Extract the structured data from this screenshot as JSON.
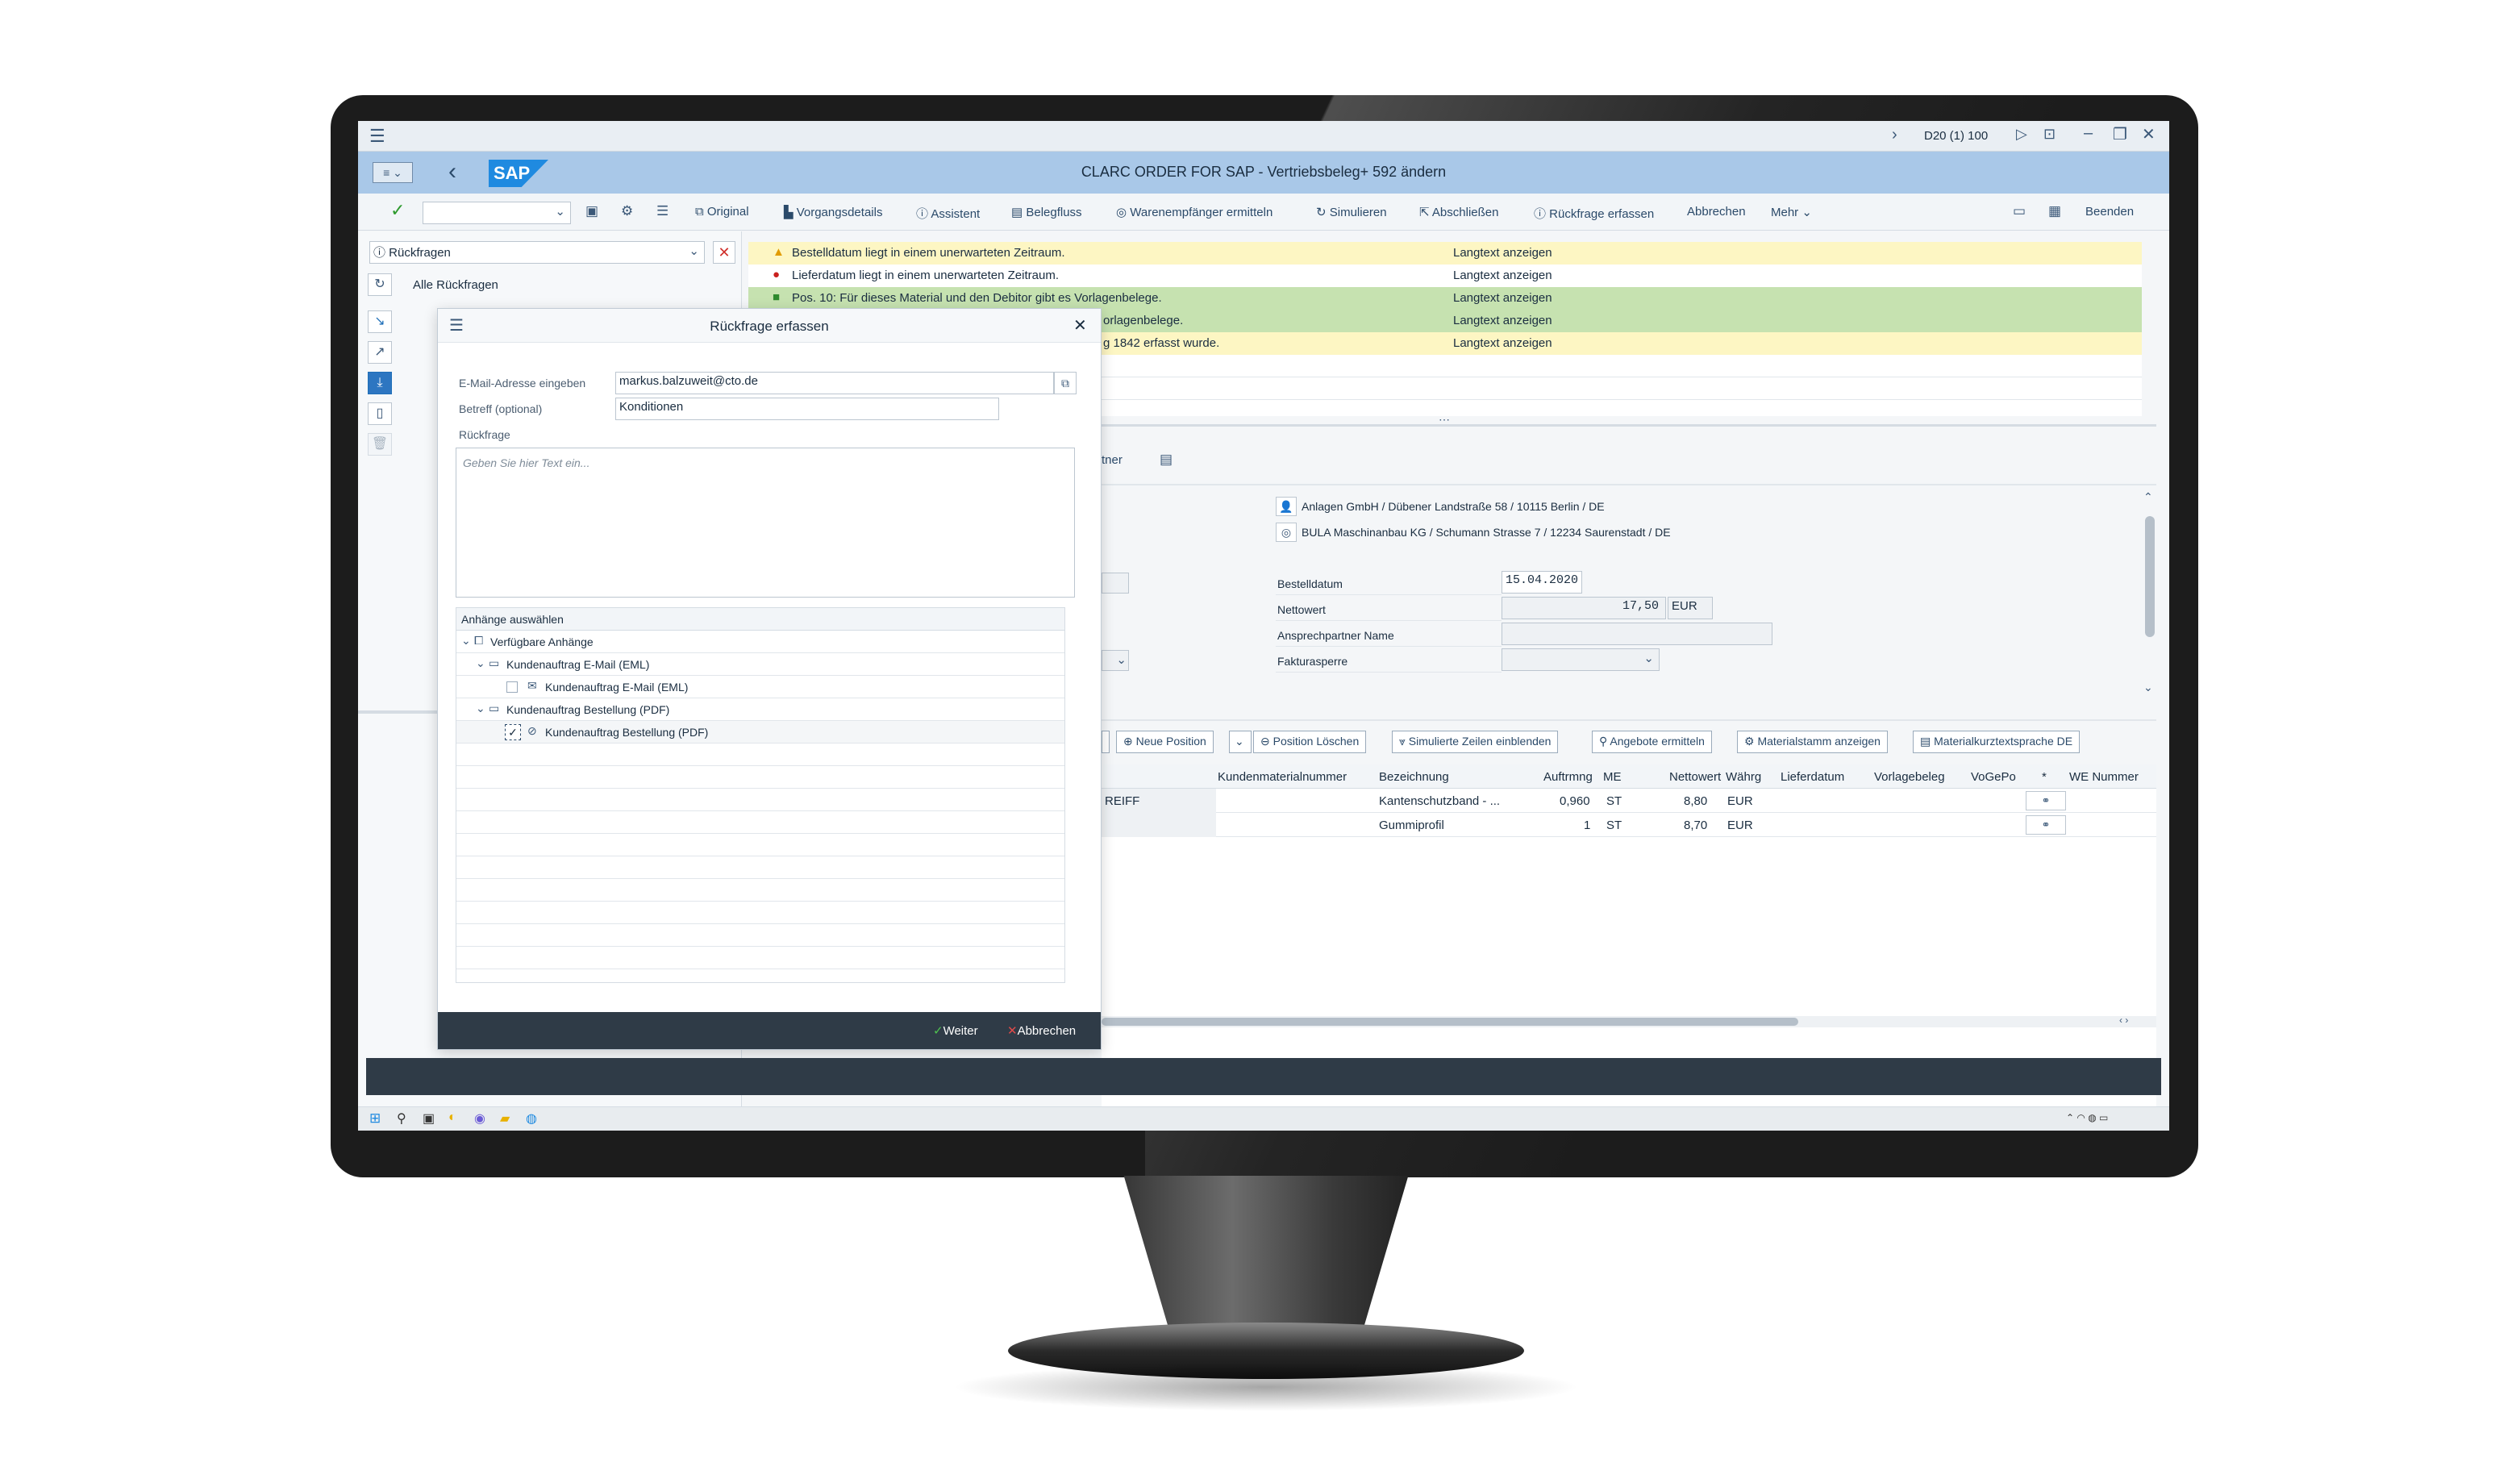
{
  "window": {
    "system_label": "D20 (1) 100",
    "title": "CLARC ORDER FOR SAP - Vertriebsbeleg+ 592 ändern",
    "logo_text": "SAP"
  },
  "toolbar": {
    "original": "Original",
    "vorgangsdetails": "Vorgangsdetails",
    "assistent": "Assistent",
    "belegfluss": "Belegfluss",
    "warenempfaenger": "Warenempfänger ermitteln",
    "simulieren": "Simulieren",
    "abschliessen": "Abschließen",
    "rueckfrage": "Rückfrage erfassen",
    "abbrechen": "Abbrechen",
    "mehr": "Mehr",
    "beenden": "Beenden"
  },
  "left_panel": {
    "dropdown": "Rückfragen",
    "all_label": "Alle Rückfragen"
  },
  "messages": [
    {
      "type": "warning",
      "text": "Bestelldatum liegt in einem unerwarteten Zeitraum.",
      "action": "Langtext anzeigen"
    },
    {
      "type": "error",
      "text": "Lieferdatum liegt in einem unerwarteten Zeitraum.",
      "action": "Langtext anzeigen"
    },
    {
      "type": "success",
      "text": "Pos. 10: Für dieses Material und den Debitor gibt es Vorlagenbelege.",
      "action": "Langtext anzeigen"
    },
    {
      "type": "success",
      "text": "orlagenbelege.",
      "action": "Langtext anzeigen"
    },
    {
      "type": "warning",
      "text": "g 1842 erfasst wurde.",
      "action": "Langtext anzeigen"
    }
  ],
  "main": {
    "tab_partial": "tner",
    "partner1": "Anlagen GmbH / Dübener Landstraße 58 / 10115 Berlin / DE",
    "partner2": "BULA Maschinanbau KG / Schumann Strasse 7 / 12234 Saurenstadt / DE",
    "bestelldatum_label": "Bestelldatum",
    "bestelldatum_value": "15.04.2020",
    "nettowert_label": "Nettowert",
    "nettowert_value": "17,50",
    "nettowert_currency": "EUR",
    "ansprech_label": "Ansprechpartner Name",
    "faktura_label": "Fakturasperre"
  },
  "item_toolbar": {
    "neue_position": "Neue Position",
    "position_loeschen": "Position Löschen",
    "simulierte": "Simulierte Zeilen einblenden",
    "angebote": "Angebote ermitteln",
    "materialstamm": "Materialstamm anzeigen",
    "materialkurztext": "Materialkurztextsprache DE"
  },
  "table": {
    "headers": [
      "Kundenmaterialnummer",
      "Bezeichnung",
      "Auftrmng",
      "ME",
      "Nettowert",
      "Währg",
      "Lieferdatum",
      "Vorlagebeleg",
      "VoGePo",
      "*",
      "WE Nummer"
    ],
    "rows": [
      {
        "partial": "REIFF",
        "bezeichnung": "Kantenschutzband - ...",
        "menge": "0,960",
        "me": "ST",
        "netto": "8,80",
        "waehrung": "EUR"
      },
      {
        "partial": "",
        "bezeichnung": "Gummiprofil",
        "menge": "1",
        "me": "ST",
        "netto": "8,70",
        "waehrung": "EUR"
      }
    ]
  },
  "dialog": {
    "title": "Rückfrage erfassen",
    "email_label": "E-Mail-Adresse eingeben",
    "email_value": "markus.balzuweit@cto.de",
    "betreff_label": "Betreff (optional)",
    "betreff_value": "Konditionen",
    "rueckfrage_label": "Rückfrage",
    "textarea_placeholder": "Geben Sie hier Text ein...",
    "attachments_header": "Anhänge auswählen",
    "tree": {
      "root": "Verfügbare Anhänge",
      "folder1": "Kundenauftrag E-Mail (EML)",
      "file1": "Kundenauftrag E-Mail (EML)",
      "folder2": "Kundenauftrag Bestellung (PDF)",
      "file2": "Kundenauftrag Bestellung (PDF)"
    },
    "weiter": "Weiter",
    "abbrechen": "Abbrechen"
  },
  "colors": {
    "header_blue": "#a9c8e8",
    "warning_bg": "#fdf6c3",
    "success_bg": "#c6e2b0",
    "dialog_footer": "#2f3b47",
    "sap_blue": "#1f8ae0"
  },
  "icons": {
    "menu": "hamburger-icon",
    "back": "chevron-left-icon",
    "check": "check-icon",
    "close": "close-icon"
  }
}
